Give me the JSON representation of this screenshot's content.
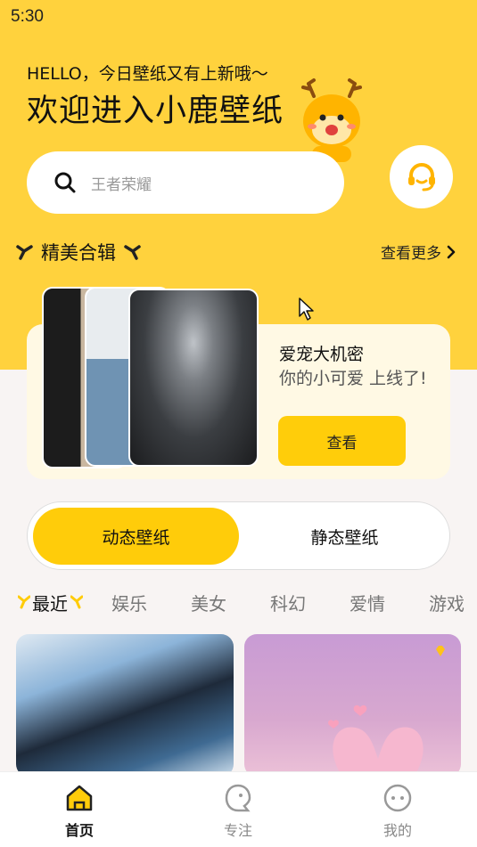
{
  "status": {
    "time": "5:30"
  },
  "header": {
    "greeting": "HELLO，今日壁纸又有上新哦～",
    "title": "欢迎进入小鹿壁纸"
  },
  "search": {
    "placeholder": "王者荣耀"
  },
  "section": {
    "title": "精美合辑",
    "more_label": "查看更多"
  },
  "featured": {
    "title": "爱宠大机密",
    "subtitle": "你的小可爱 上线了!",
    "button": "查看"
  },
  "toggle": {
    "active": "动态壁纸",
    "inactive": "静态壁纸"
  },
  "categories": [
    "最近",
    "娱乐",
    "美女",
    "科幻",
    "爱情",
    "游戏"
  ],
  "bottom_nav": {
    "items": [
      {
        "label": "首页",
        "icon": "home-icon",
        "active": true
      },
      {
        "label": "专注",
        "icon": "focus-icon",
        "active": false
      },
      {
        "label": "我的",
        "icon": "profile-icon",
        "active": false
      }
    ]
  },
  "colors": {
    "accent": "#ffd23d",
    "button": "#ffcd0a",
    "card": "#fff9e4"
  }
}
